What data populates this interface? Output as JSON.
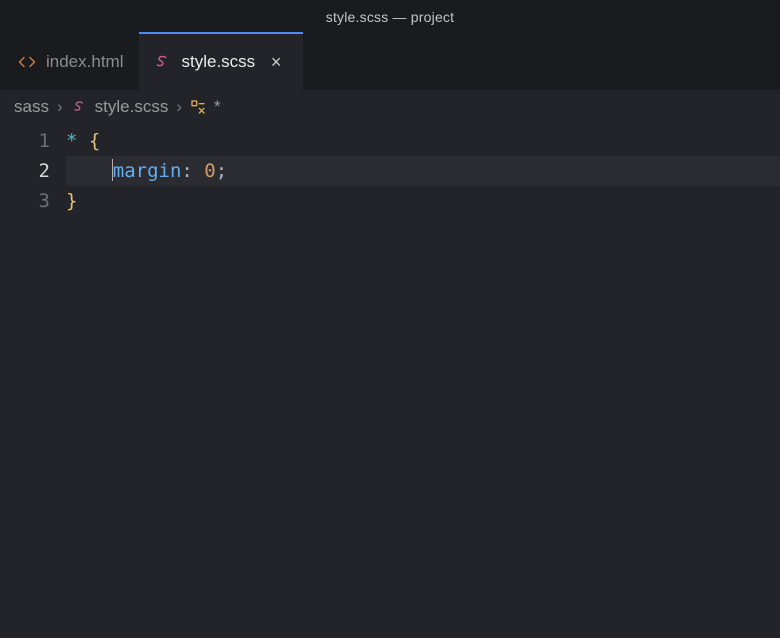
{
  "window": {
    "title": "style.scss — project"
  },
  "tabs": [
    {
      "label": "index.html",
      "icon": "code-icon",
      "active": false
    },
    {
      "label": "style.scss",
      "icon": "sass-icon",
      "active": true
    }
  ],
  "breadcrumbs": {
    "items": [
      {
        "label": "sass",
        "icon": null
      },
      {
        "label": "style.scss",
        "icon": "sass-icon"
      },
      {
        "label": "*",
        "icon": "rule-icon"
      }
    ],
    "sep": "›"
  },
  "editor": {
    "lineStart": 1,
    "currentLine": 2,
    "lines": [
      {
        "n": "1",
        "tokens": [
          {
            "t": "*",
            "c": "tok-sel"
          },
          {
            "t": " ",
            "c": ""
          },
          {
            "t": "{",
            "c": "tok-brace"
          }
        ]
      },
      {
        "n": "2",
        "tokens": [
          {
            "t": "    ",
            "c": ""
          },
          {
            "t": "margin",
            "c": "tok-prop"
          },
          {
            "t": ": ",
            "c": "tok-punc"
          },
          {
            "t": "0",
            "c": "tok-num"
          },
          {
            "t": ";",
            "c": "tok-punc"
          }
        ],
        "cursorBefore": 1
      },
      {
        "n": "3",
        "tokens": [
          {
            "t": "}",
            "c": "tok-brace"
          }
        ]
      }
    ]
  },
  "icons": {
    "close": "×"
  }
}
